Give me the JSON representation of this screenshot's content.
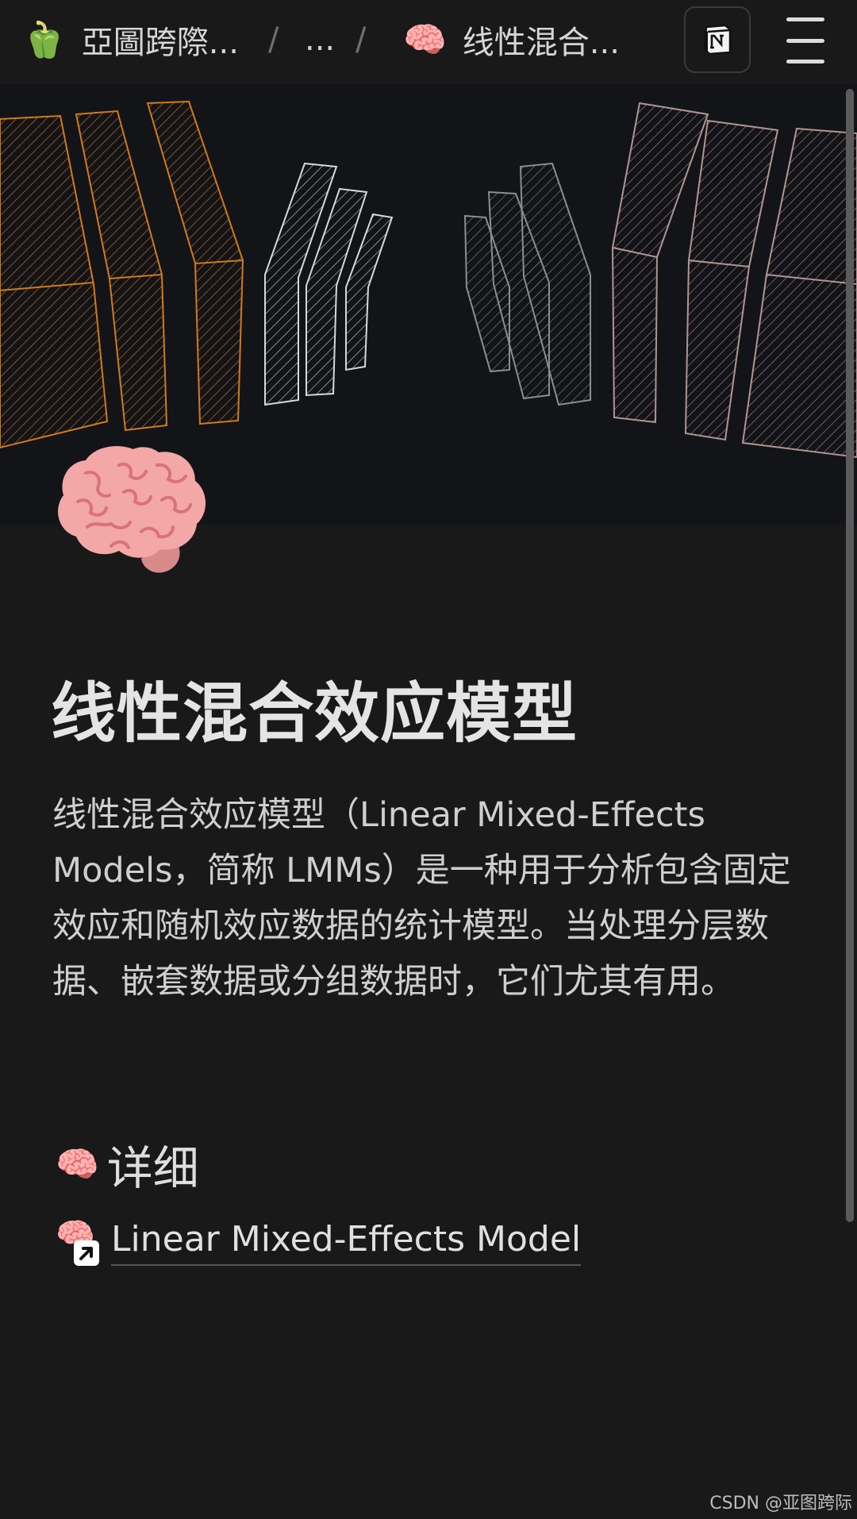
{
  "breadcrumb": {
    "workspace_icon": "🫑",
    "workspace_label": "亞圖跨際...",
    "separator": "/",
    "ellipsis": "...",
    "page_icon": "🧠",
    "page_label": "线性混合..."
  },
  "header": {
    "notion_icon": "notion-logo-icon",
    "menu_icon": "hamburger-menu-icon"
  },
  "page": {
    "icon": "🧠",
    "title": "线性混合效应模型",
    "description": "线性混合效应模型（Linear Mixed-Effects Models，简称 LMMs）是一种用于分析包含固定效应和随机效应数据的统计模型。当处理分层数据、嵌套数据或分组数据时，它们尤其有用。"
  },
  "details": {
    "heading_icon": "🧠",
    "heading": "详细",
    "link_icon": "🧠",
    "link_label": "Linear Mixed-Effects Model"
  },
  "watermark": "CSDN @亚图跨际",
  "colors": {
    "background": "#191919",
    "cover_background": "#121418",
    "cover_orange": "#d07a1e",
    "cover_white": "#d8d8d8",
    "cover_gray": "#8a8d92",
    "cover_pink": "#b09590"
  }
}
